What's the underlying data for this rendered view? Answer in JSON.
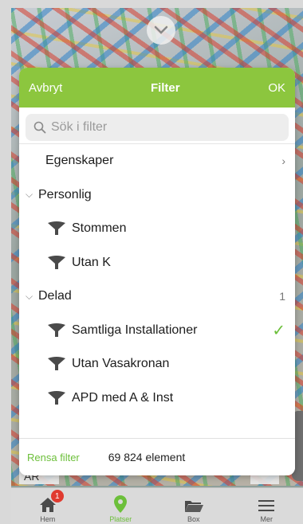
{
  "header": {
    "cancel_label": "Avbryt",
    "title": "Filter",
    "ok_label": "OK"
  },
  "search": {
    "placeholder": "Sök i filter"
  },
  "list": {
    "properties_label": "Egenskaper",
    "personal_section": {
      "label": "Personlig",
      "items": [
        "Stommen",
        "Utan K"
      ]
    },
    "shared_section": {
      "label": "Delad",
      "count": "1",
      "items": [
        "Samtliga Installationer",
        "Utan Vasakronan",
        "APD med A & Inst"
      ]
    }
  },
  "footer": {
    "clear_label": "Rensa filter",
    "element_count": "69 824 element"
  },
  "background": {
    "left_label": "AR"
  },
  "tabbar": {
    "home": {
      "label": "Hem",
      "badge": "1"
    },
    "places": {
      "label": "Platser"
    },
    "box": {
      "label": "Box"
    },
    "more": {
      "label": "Mer"
    }
  },
  "colors": {
    "accent": "#8cc63e",
    "check": "#6cbf3a",
    "badge": "#e03a2f"
  }
}
